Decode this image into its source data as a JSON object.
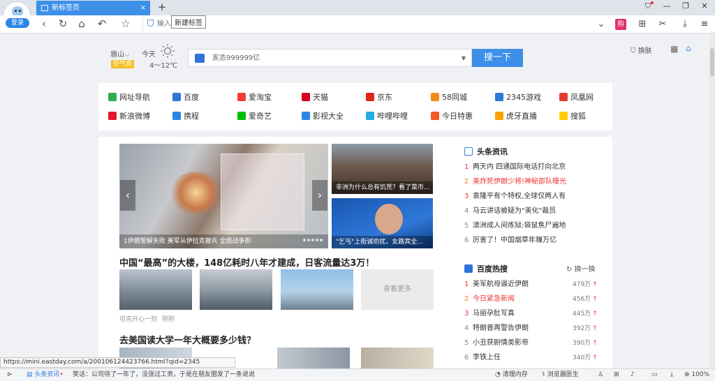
{
  "browser": {
    "login_label": "登录",
    "tab_title": "新标签页",
    "tab_close": "×",
    "new_tab": "+",
    "tooltip": "新建标签",
    "address_text": "输入网址或搜索",
    "status_url": "https://mini.eastday.com/a/200106124423766.html?qid=2345"
  },
  "weather": {
    "city": "眉山",
    "city_caret": "⌵",
    "air_quality": "空气良",
    "day": "今天",
    "temperature": "4～12℃"
  },
  "search": {
    "placeholder": "亥态999999亿",
    "button": "搜一下",
    "dropdown": "▼"
  },
  "header_tools": {
    "skin": "换肤"
  },
  "site_links": [
    {
      "label": "网址导航",
      "color": "#2cae4a"
    },
    {
      "label": "百度",
      "color": "#2f73d8"
    },
    {
      "label": "爱淘宝",
      "color": "#f23b3b"
    },
    {
      "label": "天猫",
      "color": "#d6001c"
    },
    {
      "label": "京东",
      "color": "#e1251b"
    },
    {
      "label": "58同城",
      "color": "#f08a1a"
    },
    {
      "label": "2345游戏",
      "color": "#2a7bd8"
    },
    {
      "label": "凤凰网",
      "color": "#e33b2e"
    },
    {
      "label": "新浪微博",
      "color": "#e6162d"
    },
    {
      "label": "携程",
      "color": "#2a86e6"
    },
    {
      "label": "爱奇艺",
      "color": "#00be06"
    },
    {
      "label": "影视大全",
      "color": "#2a86e6"
    },
    {
      "label": "哔哩哔哩",
      "color": "#23ade5"
    },
    {
      "label": "今日特惠",
      "color": "#f05a28"
    },
    {
      "label": "虎牙直播",
      "color": "#f8a300"
    },
    {
      "label": "搜狐",
      "color": "#ffcc00"
    }
  ],
  "carousel": {
    "caption": "1伊朗誓解失败 美军从伊拉克撤兵 全面战争即",
    "prev": "‹",
    "next": "›"
  },
  "news_thumbs": [
    {
      "caption": "非洲为什么总有饥荒？看了菜市..."
    },
    {
      "caption": "\"乞丐\"上街诚劝扰，女路宾全..."
    }
  ],
  "article1": {
    "title": "中国“最高”的大楼，148亿耗时八年才建成，日客流量达3万！",
    "more": "查看更多",
    "meta_source": "坦克开心一刻",
    "meta_time": "刚刚"
  },
  "article2": {
    "title": "去美国读大学一年大概要多少钱？"
  },
  "headlines": {
    "title": "头条资讯",
    "items": [
      {
        "num": "1",
        "text": "两天内 四通国际电话打向北京"
      },
      {
        "num": "2",
        "text": "美炸死伊朗少将!神秘部队曝光"
      },
      {
        "num": "3",
        "text": "袁隆平有个特权,全球仅两人有"
      },
      {
        "num": "4",
        "text": "马云讲话被疑为\"美化\"裁员"
      },
      {
        "num": "5",
        "text": "澳洲成人间炼狱:袋鼠焦尸遍地"
      },
      {
        "num": "6",
        "text": "厉害了！中国烟草年赚万亿"
      }
    ]
  },
  "hot": {
    "title": "百度热搜",
    "refresh": "换一换",
    "items": [
      {
        "num": "1",
        "text": "美军航母逼近伊朗",
        "value": "479万"
      },
      {
        "num": "2",
        "text": "今日紧急新闻",
        "value": "456万"
      },
      {
        "num": "3",
        "text": "马丽孕肚写真",
        "value": "445万"
      },
      {
        "num": "4",
        "text": "特朗普再警告伊朗",
        "value": "392万"
      },
      {
        "num": "5",
        "text": "小丑获剧情类影帝",
        "value": "390万"
      },
      {
        "num": "6",
        "text": "李铁上任",
        "value": "340万"
      }
    ]
  },
  "statusbar": {
    "news_label": "头条资讯",
    "news_text": "笑话：公司待了一年了，没涨过工资，于是在朋友圈发了一条说说",
    "clean": "清理内存",
    "doctor": "浏览器医生",
    "zoom": "100%"
  }
}
